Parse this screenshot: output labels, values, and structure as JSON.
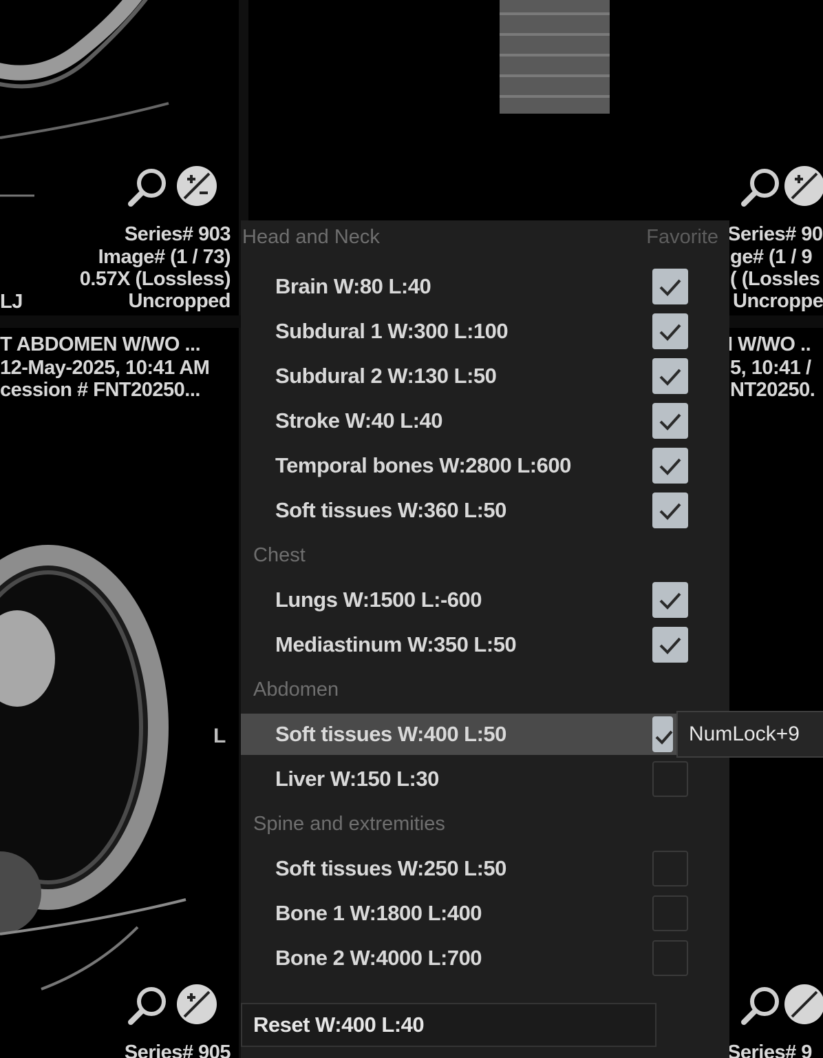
{
  "viewports": {
    "top_left": {
      "series": "Series# 903",
      "image": "Image# (1 / 73)",
      "zoom": "0.57X (Lossless)",
      "crop": "Uncropped",
      "left_marker": "LJ"
    },
    "top_right": {
      "series": "Series# 90",
      "image": "ge# (1 / 9",
      "zoom": "( (Lossles",
      "crop": "Uncroppe"
    },
    "bottom_left": {
      "study": "T ABDOMEN W/WO ...",
      "datetime": "12-May-2025, 10:41 AM",
      "accession": "cession # FNT20250...",
      "orientation": "L",
      "series": "Series# 905"
    },
    "bottom_right": {
      "study": "I W/WO ..",
      "datetime": "5, 10:41 /",
      "accession": "NT20250.",
      "series": "Series# 9"
    }
  },
  "menu": {
    "favorite_header": "Favorite",
    "sections": [
      {
        "title": "Head and Neck",
        "items": [
          {
            "label": "Brain W:80 L:40",
            "favorite": true
          },
          {
            "label": "Subdural 1 W:300 L:100",
            "favorite": true
          },
          {
            "label": "Subdural 2 W:130 L:50",
            "favorite": true
          },
          {
            "label": "Stroke W:40 L:40",
            "favorite": true
          },
          {
            "label": "Temporal bones W:2800 L:600",
            "favorite": true
          },
          {
            "label": "Soft tissues W:360 L:50",
            "favorite": true
          }
        ]
      },
      {
        "title": "Chest",
        "items": [
          {
            "label": "Lungs W:1500 L:-600",
            "favorite": true
          },
          {
            "label": "Mediastinum W:350 L:50",
            "favorite": true
          }
        ]
      },
      {
        "title": "Abdomen",
        "items": [
          {
            "label": "Soft tissues W:400 L:50",
            "favorite": true,
            "highlighted": true
          },
          {
            "label": "Liver W:150 L:30",
            "favorite": false
          }
        ]
      },
      {
        "title": "Spine and extremities",
        "items": [
          {
            "label": "Soft tissues W:250 L:50",
            "favorite": false
          },
          {
            "label": "Bone 1 W:1800 L:400",
            "favorite": false
          },
          {
            "label": "Bone 2 W:4000 L:700",
            "favorite": false
          }
        ]
      }
    ],
    "reset_label": "Reset W:400 L:40",
    "tooltip": "NumLock+9"
  },
  "colors": {
    "menu_bg": "#1f1f1f",
    "highlight": "#4a4a4a",
    "checkbox_on": "#b9c0c6",
    "text": "#d9d9d9"
  }
}
